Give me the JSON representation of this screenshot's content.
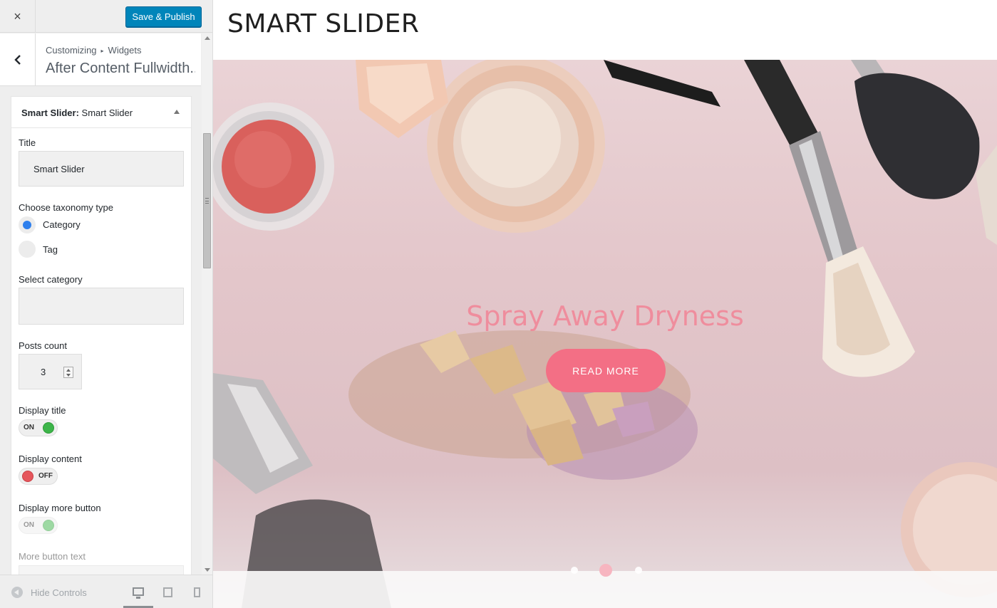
{
  "topbar": {
    "close_icon": "×",
    "publish_label": "Save & Publish"
  },
  "panel": {
    "breadcrumb_root": "Customizing",
    "breadcrumb_sep": "▸",
    "breadcrumb_section": "Widgets",
    "title": "After Content Fullwidth..."
  },
  "widget": {
    "header_bold": "Smart Slider:",
    "header_name": " Smart Slider",
    "title_label": "Title",
    "title_value": "Smart Slider",
    "taxonomy_label": "Choose taxonomy type",
    "taxonomy_options": [
      {
        "label": "Category",
        "checked": true
      },
      {
        "label": "Tag",
        "checked": false
      }
    ],
    "select_category_label": "Select category",
    "posts_count_label": "Posts count",
    "posts_count_value": "3",
    "display_title_label": "Display title",
    "display_title_state": "ON",
    "display_content_label": "Display content",
    "display_content_state": "OFF",
    "display_more_button_label": "Display more button",
    "display_more_button_state": "ON",
    "more_button_text_label": "More button text"
  },
  "footer": {
    "hide_controls_label": "Hide Controls",
    "devices": [
      "desktop-icon",
      "tablet-icon",
      "mobile-icon"
    ]
  },
  "preview": {
    "site_title": "SMART SLIDER",
    "slide_title": "Spray Away Dryness",
    "read_more_label": "READ MORE",
    "slide_count": 3,
    "active_slide": 2
  },
  "colors": {
    "publish_button": "#0085ba",
    "toggle_on": "#3db54a",
    "toggle_off": "#e5565c",
    "slide_title": "#f47b8f",
    "read_more_bg": "#f36f85"
  }
}
